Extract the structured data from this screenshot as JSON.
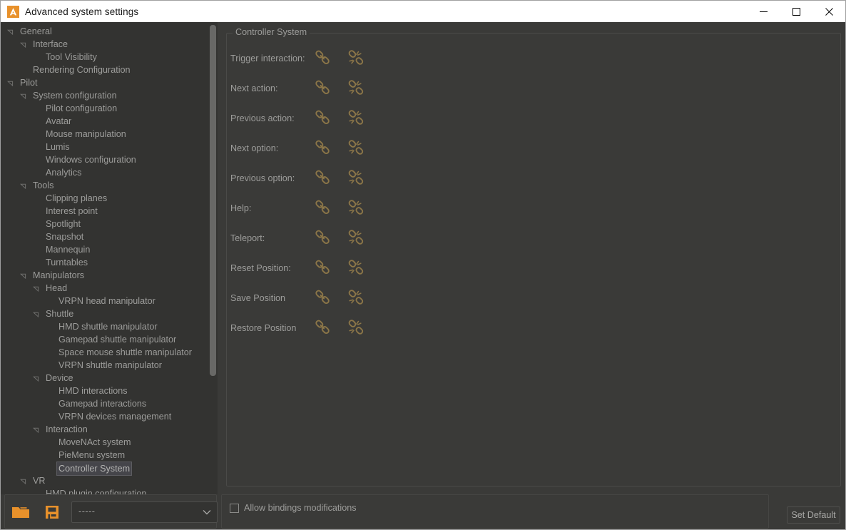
{
  "window": {
    "title": "Advanced system settings",
    "app_icon": "autodesk-a-icon",
    "accent_color": "#e8912b",
    "background_color": "#3a3a38",
    "panel_color": "#333331",
    "text_color": "#9d9d9b",
    "controls": {
      "minimize": "minimize-icon",
      "maximize": "maximize-icon",
      "close": "close-icon"
    }
  },
  "tree": {
    "selected": "Controller System",
    "items": [
      {
        "label": "General",
        "depth": 0,
        "expander": "expanded"
      },
      {
        "label": "Interface",
        "depth": 1,
        "expander": "expanded"
      },
      {
        "label": "Tool Visibility",
        "depth": 2,
        "expander": "none"
      },
      {
        "label": "Rendering Configuration",
        "depth": 1,
        "expander": "none"
      },
      {
        "label": "Pilot",
        "depth": 0,
        "expander": "expanded"
      },
      {
        "label": "System configuration",
        "depth": 1,
        "expander": "expanded"
      },
      {
        "label": "Pilot configuration",
        "depth": 2,
        "expander": "none"
      },
      {
        "label": "Avatar",
        "depth": 2,
        "expander": "none"
      },
      {
        "label": "Mouse manipulation",
        "depth": 2,
        "expander": "none"
      },
      {
        "label": "Lumis",
        "depth": 2,
        "expander": "none"
      },
      {
        "label": "Windows configuration",
        "depth": 2,
        "expander": "none"
      },
      {
        "label": "Analytics",
        "depth": 2,
        "expander": "none"
      },
      {
        "label": "Tools",
        "depth": 1,
        "expander": "expanded"
      },
      {
        "label": "Clipping planes",
        "depth": 2,
        "expander": "none"
      },
      {
        "label": "Interest point",
        "depth": 2,
        "expander": "none"
      },
      {
        "label": "Spotlight",
        "depth": 2,
        "expander": "none"
      },
      {
        "label": "Snapshot",
        "depth": 2,
        "expander": "none"
      },
      {
        "label": "Mannequin",
        "depth": 2,
        "expander": "none"
      },
      {
        "label": "Turntables",
        "depth": 2,
        "expander": "none"
      },
      {
        "label": "Manipulators",
        "depth": 1,
        "expander": "expanded"
      },
      {
        "label": "Head",
        "depth": 2,
        "expander": "expanded"
      },
      {
        "label": "VRPN head manipulator",
        "depth": 3,
        "expander": "none"
      },
      {
        "label": "Shuttle",
        "depth": 2,
        "expander": "expanded"
      },
      {
        "label": "HMD shuttle manipulator",
        "depth": 3,
        "expander": "none"
      },
      {
        "label": "Gamepad shuttle manipulator",
        "depth": 3,
        "expander": "none"
      },
      {
        "label": "Space mouse shuttle manipulator",
        "depth": 3,
        "expander": "none"
      },
      {
        "label": "VRPN shuttle manipulator",
        "depth": 3,
        "expander": "none"
      },
      {
        "label": "Device",
        "depth": 2,
        "expander": "expanded"
      },
      {
        "label": "HMD interactions",
        "depth": 3,
        "expander": "none"
      },
      {
        "label": "Gamepad interactions",
        "depth": 3,
        "expander": "none"
      },
      {
        "label": "VRPN devices management",
        "depth": 3,
        "expander": "none"
      },
      {
        "label": "Interaction",
        "depth": 2,
        "expander": "expanded"
      },
      {
        "label": "MoveNAct system",
        "depth": 3,
        "expander": "none"
      },
      {
        "label": "PieMenu system",
        "depth": 3,
        "expander": "none"
      },
      {
        "label": "Controller System",
        "depth": 3,
        "expander": "none",
        "selected": true
      },
      {
        "label": "VR",
        "depth": 1,
        "expander": "expanded"
      },
      {
        "label": "HMD plugin configuration",
        "depth": 2,
        "expander": "none"
      }
    ]
  },
  "panel": {
    "group_title": "Controller System",
    "bindings": [
      {
        "label": "Trigger interaction:",
        "link_icon": "link-icon",
        "unlink_icon": "broken-link-icon"
      },
      {
        "label": "Next action:",
        "link_icon": "link-icon",
        "unlink_icon": "broken-link-icon"
      },
      {
        "label": "Previous action:",
        "link_icon": "link-icon",
        "unlink_icon": "broken-link-icon"
      },
      {
        "label": "Next option:",
        "link_icon": "link-icon",
        "unlink_icon": "broken-link-icon"
      },
      {
        "label": "Previous option:",
        "link_icon": "link-icon",
        "unlink_icon": "broken-link-icon"
      },
      {
        "label": "Help:",
        "link_icon": "link-icon",
        "unlink_icon": "broken-link-icon"
      },
      {
        "label": "Teleport:",
        "link_icon": "link-icon",
        "unlink_icon": "broken-link-icon"
      },
      {
        "label": "Reset Position:",
        "link_icon": "link-icon",
        "unlink_icon": "broken-link-icon"
      },
      {
        "label": "Save Position",
        "link_icon": "link-icon",
        "unlink_icon": "broken-link-icon"
      },
      {
        "label": "Restore Position",
        "link_icon": "link-icon",
        "unlink_icon": "broken-link-icon"
      }
    ]
  },
  "bottombar": {
    "open_icon": "open-folder-icon",
    "save_icon": "save-floppy-icon",
    "profile_select": {
      "value": "-----",
      "placeholder": "-----",
      "arrow_icon": "chevron-down-icon"
    },
    "allow_bindings_label": "Allow bindings modifications",
    "allow_bindings_checked": false,
    "set_default_label": "Set Default"
  }
}
